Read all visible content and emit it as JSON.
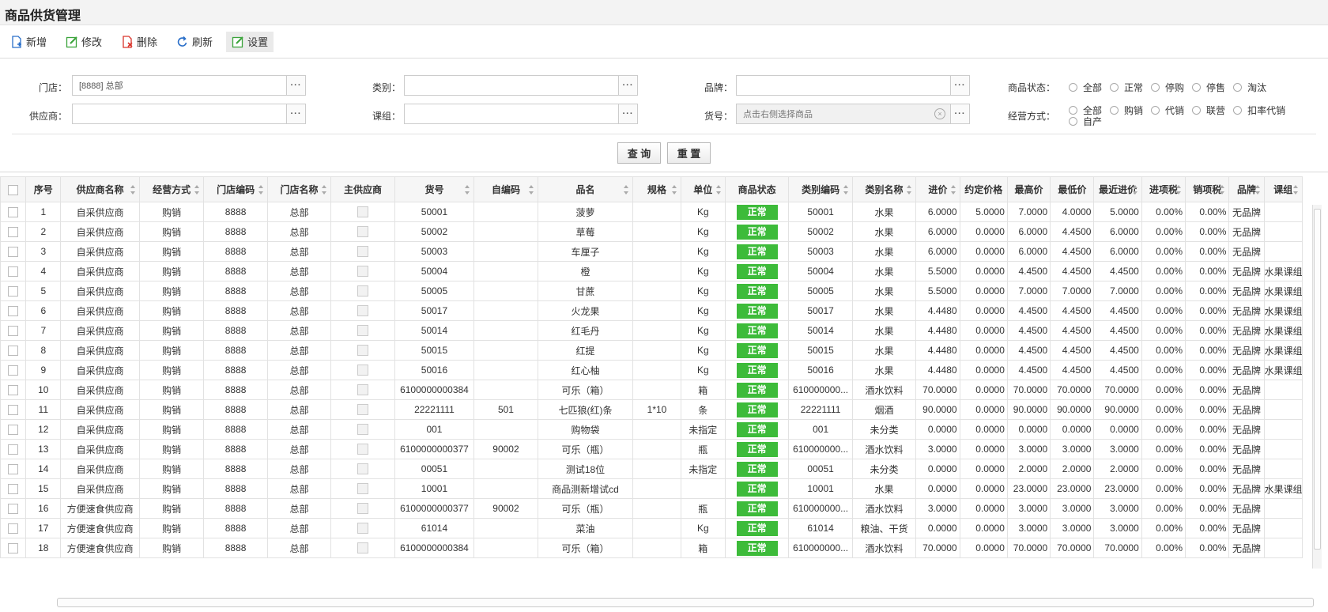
{
  "title": "商品供货管理",
  "toolbar": [
    {
      "label": "新增",
      "icon": "add-icon",
      "color": "#2a6fc9"
    },
    {
      "label": "修改",
      "icon": "edit-icon",
      "color": "#3aa33a"
    },
    {
      "label": "删除",
      "icon": "delete-icon",
      "color": "#d9342b"
    },
    {
      "label": "刷新",
      "icon": "refresh-icon",
      "color": "#2a6fc9"
    },
    {
      "label": "设置",
      "icon": "settings-icon",
      "color": "#3aa33a"
    }
  ],
  "filters": {
    "store_label": "门店：",
    "store_value": "[8888] 总部",
    "supplier_label": "供应商：",
    "supplier_value": "",
    "category_label": "类别：",
    "category_value": "",
    "group_label": "课组：",
    "group_value": "",
    "brand_label": "品牌：",
    "brand_value": "",
    "item_label": "货号：",
    "item_placeholder": "点击右侧选择商品",
    "dots": "···",
    "status_label": "商品状态：",
    "status_options": [
      "全部",
      "正常",
      "停购",
      "停售",
      "淘汰"
    ],
    "mode_label": "经营方式：",
    "mode_options": [
      "全部",
      "购销",
      "代销",
      "联营",
      "扣率代销",
      "自产"
    ]
  },
  "buttons": {
    "query": "查 询",
    "reset": "重 置"
  },
  "columns": [
    "序号",
    "供应商名称",
    "经营方式",
    "门店编码",
    "门店名称",
    "主供应商",
    "货号",
    "自编码",
    "品名",
    "规格",
    "单位",
    "商品状态",
    "类别编码",
    "类别名称",
    "进价",
    "约定价格",
    "最高价",
    "最低价",
    "最近进价",
    "进项税",
    "销项税",
    "品牌",
    "课组"
  ],
  "rows": [
    [
      "1",
      "自采供应商",
      "购销",
      "8888",
      "总部",
      "",
      "50001",
      "",
      "菠萝",
      "",
      "Kg",
      "正常",
      "50001",
      "水果",
      "6.0000",
      "5.0000",
      "7.0000",
      "4.0000",
      "5.0000",
      "0.00%",
      "0.00%",
      "无品牌",
      ""
    ],
    [
      "2",
      "自采供应商",
      "购销",
      "8888",
      "总部",
      "",
      "50002",
      "",
      "草莓",
      "",
      "Kg",
      "正常",
      "50002",
      "水果",
      "6.0000",
      "0.0000",
      "6.0000",
      "4.4500",
      "6.0000",
      "0.00%",
      "0.00%",
      "无品牌",
      ""
    ],
    [
      "3",
      "自采供应商",
      "购销",
      "8888",
      "总部",
      "",
      "50003",
      "",
      "车厘子",
      "",
      "Kg",
      "正常",
      "50003",
      "水果",
      "6.0000",
      "0.0000",
      "6.0000",
      "4.4500",
      "6.0000",
      "0.00%",
      "0.00%",
      "无品牌",
      ""
    ],
    [
      "4",
      "自采供应商",
      "购销",
      "8888",
      "总部",
      "",
      "50004",
      "",
      "橙",
      "",
      "Kg",
      "正常",
      "50004",
      "水果",
      "5.5000",
      "0.0000",
      "4.4500",
      "4.4500",
      "4.4500",
      "0.00%",
      "0.00%",
      "无品牌",
      "水果课组"
    ],
    [
      "5",
      "自采供应商",
      "购销",
      "8888",
      "总部",
      "",
      "50005",
      "",
      "甘蔗",
      "",
      "Kg",
      "正常",
      "50005",
      "水果",
      "5.5000",
      "0.0000",
      "7.0000",
      "7.0000",
      "7.0000",
      "0.00%",
      "0.00%",
      "无品牌",
      "水果课组"
    ],
    [
      "6",
      "自采供应商",
      "购销",
      "8888",
      "总部",
      "",
      "50017",
      "",
      "火龙果",
      "",
      "Kg",
      "正常",
      "50017",
      "水果",
      "4.4480",
      "0.0000",
      "4.4500",
      "4.4500",
      "4.4500",
      "0.00%",
      "0.00%",
      "无品牌",
      "水果课组"
    ],
    [
      "7",
      "自采供应商",
      "购销",
      "8888",
      "总部",
      "",
      "50014",
      "",
      "红毛丹",
      "",
      "Kg",
      "正常",
      "50014",
      "水果",
      "4.4480",
      "0.0000",
      "4.4500",
      "4.4500",
      "4.4500",
      "0.00%",
      "0.00%",
      "无品牌",
      "水果课组"
    ],
    [
      "8",
      "自采供应商",
      "购销",
      "8888",
      "总部",
      "",
      "50015",
      "",
      "红提",
      "",
      "Kg",
      "正常",
      "50015",
      "水果",
      "4.4480",
      "0.0000",
      "4.4500",
      "4.4500",
      "4.4500",
      "0.00%",
      "0.00%",
      "无品牌",
      "水果课组"
    ],
    [
      "9",
      "自采供应商",
      "购销",
      "8888",
      "总部",
      "",
      "50016",
      "",
      "红心柚",
      "",
      "Kg",
      "正常",
      "50016",
      "水果",
      "4.4480",
      "0.0000",
      "4.4500",
      "4.4500",
      "4.4500",
      "0.00%",
      "0.00%",
      "无品牌",
      "水果课组"
    ],
    [
      "10",
      "自采供应商",
      "购销",
      "8888",
      "总部",
      "",
      "6100000000384",
      "",
      "可乐（箱）",
      "",
      "箱",
      "正常",
      "610000000...",
      "酒水饮料",
      "70.0000",
      "0.0000",
      "70.0000",
      "70.0000",
      "70.0000",
      "0.00%",
      "0.00%",
      "无品牌",
      ""
    ],
    [
      "11",
      "自采供应商",
      "购销",
      "8888",
      "总部",
      "",
      "22221111",
      "501",
      "七匹狼(红)条",
      "1*10",
      "条",
      "正常",
      "22221111",
      "烟酒",
      "90.0000",
      "0.0000",
      "90.0000",
      "90.0000",
      "90.0000",
      "0.00%",
      "0.00%",
      "无品牌",
      ""
    ],
    [
      "12",
      "自采供应商",
      "购销",
      "8888",
      "总部",
      "",
      "001",
      "",
      "购物袋",
      "",
      "未指定",
      "正常",
      "001",
      "未分类",
      "0.0000",
      "0.0000",
      "0.0000",
      "0.0000",
      "0.0000",
      "0.00%",
      "0.00%",
      "无品牌",
      ""
    ],
    [
      "13",
      "自采供应商",
      "购销",
      "8888",
      "总部",
      "",
      "6100000000377",
      "90002",
      "可乐（瓶）",
      "",
      "瓶",
      "正常",
      "610000000...",
      "酒水饮料",
      "3.0000",
      "0.0000",
      "3.0000",
      "3.0000",
      "3.0000",
      "0.00%",
      "0.00%",
      "无品牌",
      ""
    ],
    [
      "14",
      "自采供应商",
      "购销",
      "8888",
      "总部",
      "",
      "00051",
      "",
      "测试18位",
      "",
      "未指定",
      "正常",
      "00051",
      "未分类",
      "0.0000",
      "0.0000",
      "2.0000",
      "2.0000",
      "2.0000",
      "0.00%",
      "0.00%",
      "无品牌",
      ""
    ],
    [
      "15",
      "自采供应商",
      "购销",
      "8888",
      "总部",
      "",
      "10001",
      "",
      "商品测新增试cd",
      "",
      "",
      "正常",
      "10001",
      "水果",
      "0.0000",
      "0.0000",
      "23.0000",
      "23.0000",
      "23.0000",
      "0.00%",
      "0.00%",
      "无品牌",
      "水果课组"
    ],
    [
      "16",
      "方便速食供应商",
      "购销",
      "8888",
      "总部",
      "",
      "6100000000377",
      "90002",
      "可乐（瓶）",
      "",
      "瓶",
      "正常",
      "610000000...",
      "酒水饮料",
      "3.0000",
      "0.0000",
      "3.0000",
      "3.0000",
      "3.0000",
      "0.00%",
      "0.00%",
      "无品牌",
      ""
    ],
    [
      "17",
      "方便速食供应商",
      "购销",
      "8888",
      "总部",
      "",
      "61014",
      "",
      "菜油",
      "",
      "Kg",
      "正常",
      "61014",
      "粮油、干货",
      "0.0000",
      "0.0000",
      "3.0000",
      "3.0000",
      "3.0000",
      "0.00%",
      "0.00%",
      "无品牌",
      ""
    ],
    [
      "18",
      "方便速食供应商",
      "购销",
      "8888",
      "总部",
      "",
      "6100000000384",
      "",
      "可乐（箱）",
      "",
      "箱",
      "正常",
      "610000000...",
      "酒水饮料",
      "70.0000",
      "0.0000",
      "70.0000",
      "70.0000",
      "70.0000",
      "0.00%",
      "0.00%",
      "无品牌",
      ""
    ]
  ],
  "status_color": "#3dbb3a"
}
